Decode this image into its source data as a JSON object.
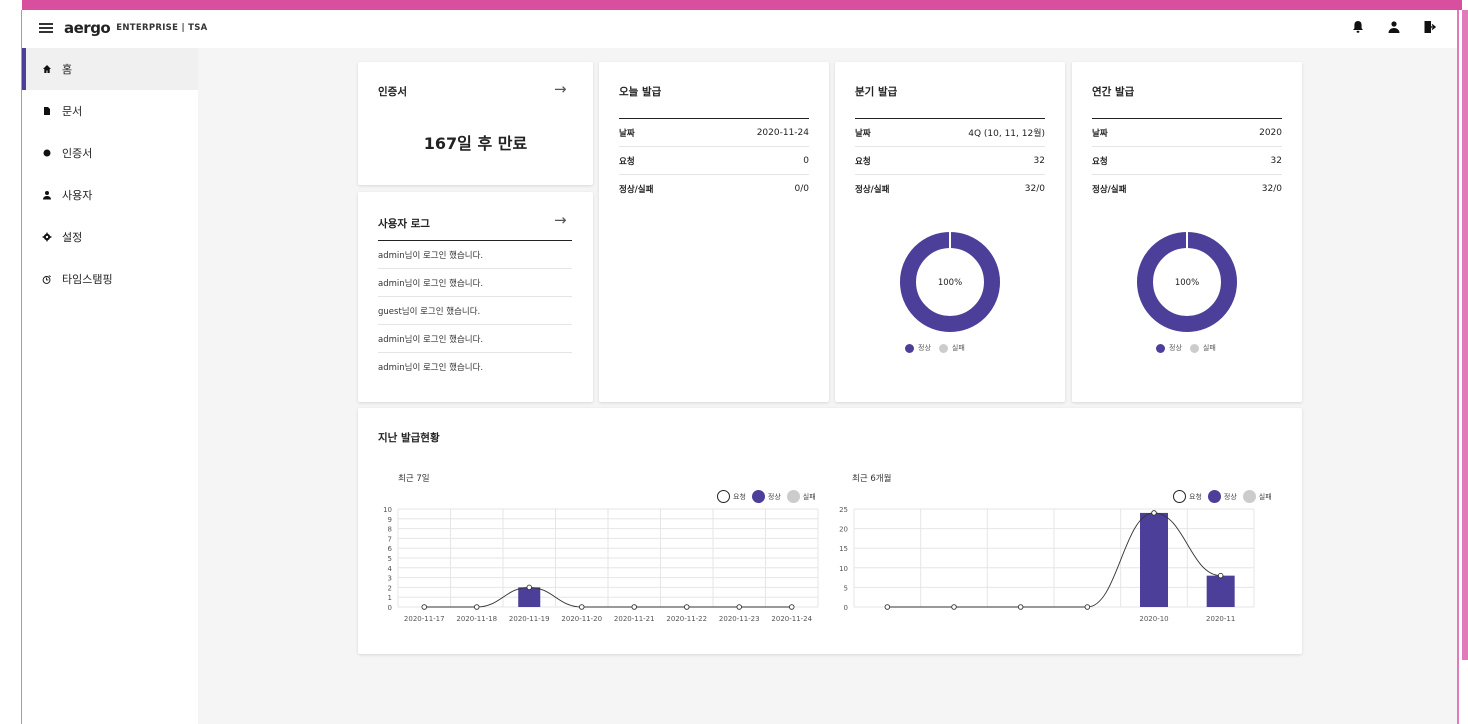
{
  "header": {
    "logo": "aergo",
    "subtitle": "ENTERPRISE | TSA"
  },
  "colors": {
    "accent": "#4b3f9a",
    "fail": "#cccccc",
    "frame": "#d94fa0"
  },
  "sidebar": {
    "items": [
      {
        "label": "홈",
        "icon": "home-icon"
      },
      {
        "label": "문서",
        "icon": "document-icon"
      },
      {
        "label": "인증서",
        "icon": "certificate-icon"
      },
      {
        "label": "사용자",
        "icon": "user-icon"
      },
      {
        "label": "설정",
        "icon": "gear-icon"
      },
      {
        "label": "타임스탬핑",
        "icon": "stamp-icon"
      }
    ]
  },
  "cert": {
    "title": "인증서",
    "expiry": "167일 후 만료"
  },
  "userlog": {
    "title": "사용자 로그",
    "entries": [
      "admin님이 로그인 했습니다.",
      "admin님이 로그인 했습니다.",
      "guest님이 로그인 했습니다.",
      "admin님이 로그인 했습니다.",
      "admin님이 로그인 했습니다."
    ]
  },
  "today": {
    "title": "오늘 발급",
    "rows": [
      {
        "k": "날짜",
        "v": "2020-11-24"
      },
      {
        "k": "요청",
        "v": "0"
      },
      {
        "k": "정상/실패",
        "v": "0/0"
      }
    ]
  },
  "quarter": {
    "title": "분기 발급",
    "rows": [
      {
        "k": "날짜",
        "v": "4Q (10, 11, 12월)"
      },
      {
        "k": "요청",
        "v": "32"
      },
      {
        "k": "정상/실패",
        "v": "32/0"
      }
    ],
    "donut_label": "100%",
    "success_fraction": 1.0,
    "legend": [
      "정상",
      "실패"
    ]
  },
  "year": {
    "title": "연간 발급",
    "rows": [
      {
        "k": "날짜",
        "v": "2020"
      },
      {
        "k": "요청",
        "v": "32"
      },
      {
        "k": "정상/실패",
        "v": "32/0"
      }
    ],
    "donut_label": "100%",
    "success_fraction": 1.0,
    "legend": [
      "정상",
      "실패"
    ]
  },
  "history": {
    "title": "지난 발급현황",
    "legend": [
      "요청",
      "정상",
      "실패"
    ]
  },
  "chart_data": [
    {
      "type": "bar",
      "title": "최근 7일",
      "categories": [
        "2020-11-17",
        "2020-11-18",
        "2020-11-19",
        "2020-11-20",
        "2020-11-21",
        "2020-11-22",
        "2020-11-23",
        "2020-11-24"
      ],
      "series": [
        {
          "name": "요청",
          "type": "line",
          "values": [
            0,
            0,
            2,
            0,
            0,
            0,
            0,
            0
          ]
        },
        {
          "name": "정상",
          "type": "bar",
          "values": [
            0,
            0,
            2,
            0,
            0,
            0,
            0,
            0
          ]
        },
        {
          "name": "실패",
          "type": "bar",
          "values": [
            0,
            0,
            0,
            0,
            0,
            0,
            0,
            0
          ]
        }
      ],
      "ylim": [
        0,
        10
      ],
      "yticks": [
        "0",
        "1",
        "2",
        "3",
        "4",
        "5",
        "6",
        "7",
        "8",
        "9",
        "10"
      ],
      "legend_position": "top-right",
      "grid": true
    },
    {
      "type": "bar",
      "title": "최근 6개월",
      "categories": [
        "",
        "",
        "",
        "",
        "2020-10",
        "2020-11"
      ],
      "series": [
        {
          "name": "요청",
          "type": "line",
          "values": [
            0,
            0,
            0,
            0,
            24,
            8
          ]
        },
        {
          "name": "정상",
          "type": "bar",
          "values": [
            0,
            0,
            0,
            0,
            24,
            8
          ]
        },
        {
          "name": "실패",
          "type": "bar",
          "values": [
            0,
            0,
            0,
            0,
            0,
            0
          ]
        }
      ],
      "ylim": [
        0,
        25
      ],
      "yticks": [
        "0",
        "5",
        "10",
        "15",
        "20",
        "25"
      ],
      "legend_position": "top-right",
      "grid": true
    }
  ]
}
